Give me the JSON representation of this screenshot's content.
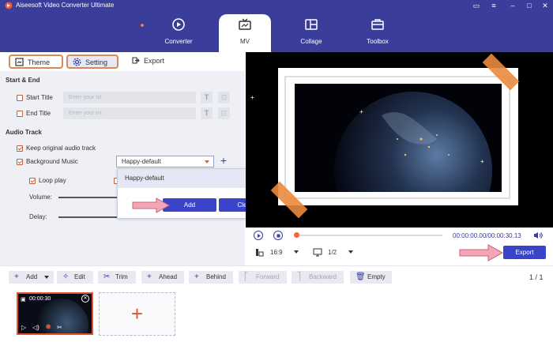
{
  "app": {
    "title": "Aiseesoft Video Converter Ultimate"
  },
  "nav": {
    "tabs": [
      {
        "label": "Converter",
        "icon": "converter-icon"
      },
      {
        "label": "MV",
        "icon": "mv-icon"
      },
      {
        "label": "Collage",
        "icon": "collage-icon"
      },
      {
        "label": "Toolbox",
        "icon": "toolbox-icon"
      }
    ],
    "active": "MV"
  },
  "subtabs": {
    "theme": "Theme",
    "setting": "Setting",
    "export": "Export"
  },
  "start_end": {
    "section": "Start & End",
    "start_title_label": "Start Title",
    "end_title_label": "End Title",
    "start_placeholder": "Enter your txt",
    "end_placeholder": "Enter your txt",
    "text_button": "T"
  },
  "audio": {
    "section": "Audio Track",
    "keep_original": "Keep original audio track",
    "background_music": "Background Music",
    "music_selected": "Happy-default",
    "loop_play": "Loop play",
    "volume_label": "Volume:",
    "delay_label": "Delay:"
  },
  "dropdown": {
    "item": "Happy-default",
    "add_label": "Add",
    "clear_label": "Clear"
  },
  "player": {
    "time": "00:00:00.00/00:00:30.13",
    "aspect": "16:9",
    "pages": "1/2",
    "export_label": "Export"
  },
  "toolbar": {
    "add": "Add",
    "edit": "Edit",
    "trim": "Trim",
    "ahead": "Ahead",
    "behind": "Behind",
    "forward": "Forward",
    "backward": "Backward",
    "empty": "Empty",
    "page": "1 / 1"
  },
  "clip": {
    "duration": "00:00:30"
  },
  "colors": {
    "brand": "#3a3d9a",
    "accent": "#e2532f",
    "button": "#3a44c8"
  }
}
